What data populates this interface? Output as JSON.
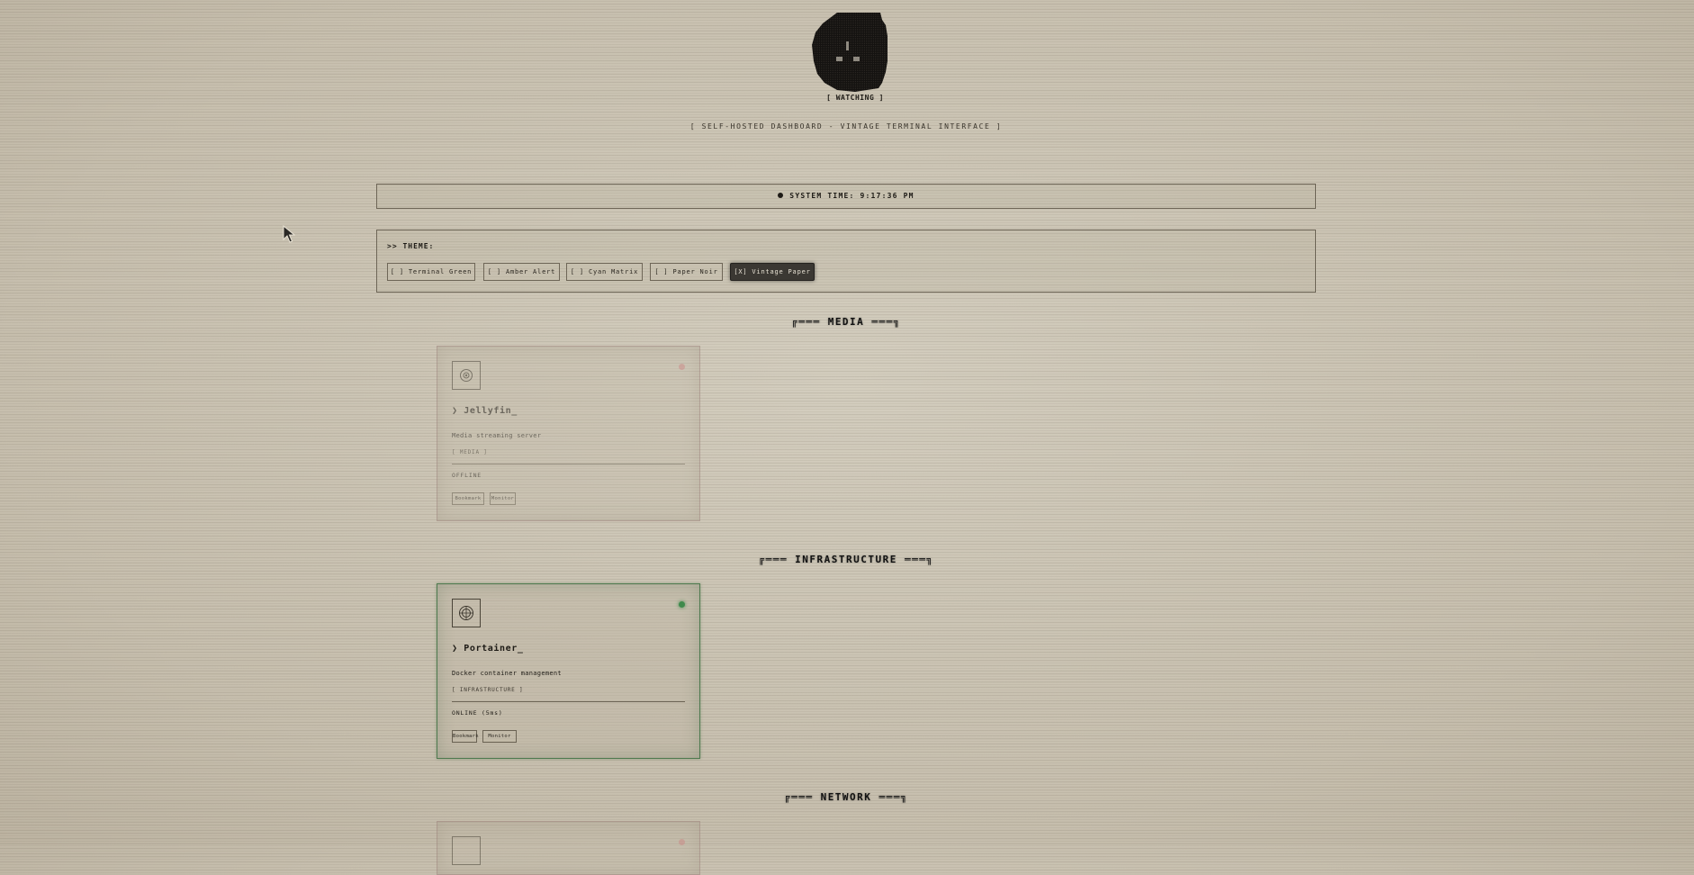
{
  "header": {
    "mascot_label": "[ WATCHING ]",
    "subtitle": "[ SELF-HOSTED DASHBOARD - VINTAGE TERMINAL INTERFACE ]"
  },
  "system": {
    "time_label": "SYSTEM TIME: 9:17:36 PM",
    "indicator_icon": "status-dot"
  },
  "theme": {
    "label": ">> THEME:",
    "options": [
      {
        "label": "[ ] Terminal Green",
        "active": false
      },
      {
        "label": "[ ] Amber Alert",
        "active": false
      },
      {
        "label": "[ ] Cyan Matrix",
        "active": false
      },
      {
        "label": "[ ] Paper Noir",
        "active": false
      },
      {
        "label": "[X] Vintage Paper",
        "active": true
      }
    ]
  },
  "sections": [
    {
      "title": "╔═══ MEDIA ═══╗",
      "cards": [
        {
          "name": "❯ Jellyfin_",
          "description": "Media streaming server",
          "tag": "[ MEDIA ]",
          "status": "OFFLINE",
          "status_color": "#c98a86",
          "icon": "jellyfin-icon",
          "actions": [
            "Bookmark",
            "Monitor"
          ]
        }
      ]
    },
    {
      "title": "╔═══ INFRASTRUCTURE ═══╗",
      "cards": [
        {
          "name": "❯ Portainer_",
          "description": "Docker container management",
          "tag": "[ INFRASTRUCTURE ]",
          "status": "ONLINE (5ms)",
          "status_color": "#3f8a4c",
          "icon": "portainer-icon",
          "actions": [
            "Bookmark",
            "Monitor"
          ]
        }
      ]
    },
    {
      "title": "╔═══ NETWORK ═══╗",
      "cards": []
    }
  ],
  "colors": {
    "background": "#cdc6b6",
    "ink": "#1e1b16",
    "active_button": "#3b3833",
    "online": "#3f8a4c",
    "offline": "#c98a86"
  }
}
